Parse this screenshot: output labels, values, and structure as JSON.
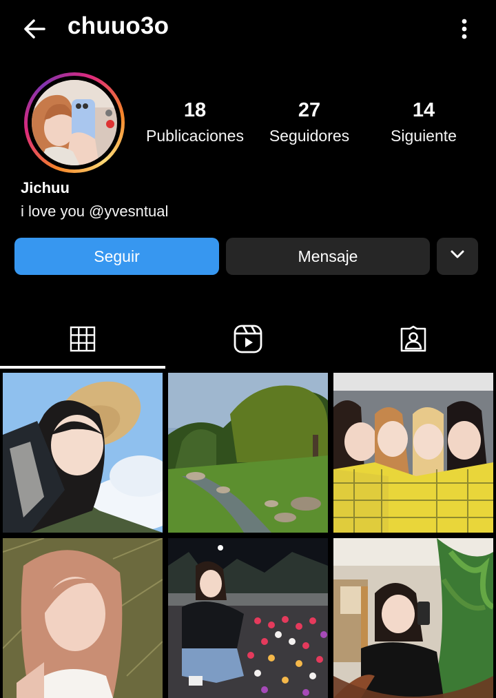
{
  "header": {
    "username": "chuuo3o",
    "back_icon": "arrow-left-icon",
    "more_icon": "more-vertical-icon"
  },
  "profile": {
    "display_name": "Jichuu",
    "bio": "i love you @yvesntual",
    "stats": [
      {
        "value": "18",
        "label": "Publicaciones"
      },
      {
        "value": "27",
        "label": "Seguidores"
      },
      {
        "value": "14",
        "label": "Siguiente"
      }
    ]
  },
  "actions": {
    "follow_label": "Seguir",
    "message_label": "Mensaje",
    "dropdown_icon": "chevron-down-icon"
  },
  "tabs": [
    {
      "icon": "grid-icon",
      "active": true
    },
    {
      "icon": "reels-icon",
      "active": false
    },
    {
      "icon": "tagged-icon",
      "active": false
    }
  ],
  "colors": {
    "background": "#000000",
    "primary_button": "#3797f0",
    "secondary_button": "#262626",
    "text": "#ffffff"
  },
  "grid": [
    {
      "subject": "selfie-straw-hat"
    },
    {
      "subject": "park-stream-landscape"
    },
    {
      "subject": "group-yellow-plaid"
    },
    {
      "subject": "selfie-pink-hair-grass"
    },
    {
      "subject": "crouching-tulips-night"
    },
    {
      "subject": "mirror-selfie-plants"
    }
  ]
}
